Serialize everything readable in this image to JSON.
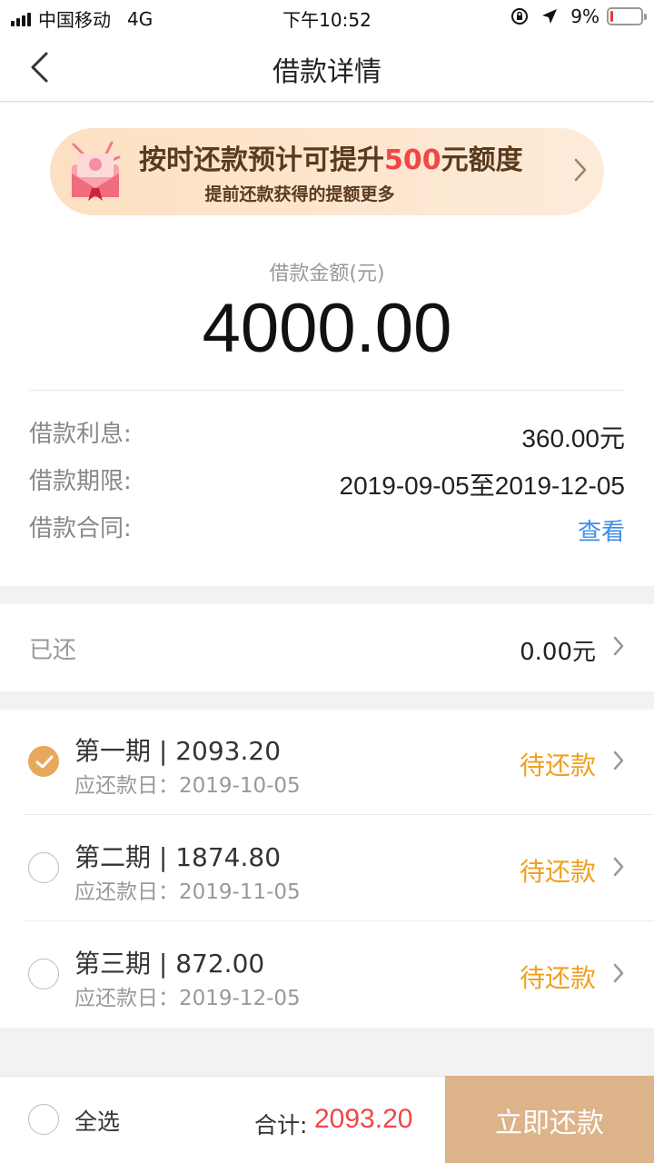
{
  "status_bar": {
    "carrier": "中国移动",
    "network": "4G",
    "time": "下午10:52",
    "battery_percent": "9%",
    "battery_level": 0.09,
    "icons": [
      "signal-icon",
      "rotation-lock-icon",
      "location-arrow-icon",
      "battery-icon"
    ]
  },
  "nav": {
    "title": "借款详情",
    "back_icon": "back-arrow-icon"
  },
  "banner": {
    "main_prefix": "按时还款预计可提升",
    "main_highlight": "500",
    "main_suffix": "元额度",
    "sub": "提前还款获得的提额更多",
    "highlight_color": "#f04747"
  },
  "loan": {
    "amount_label": "借款金额(元)",
    "amount": "4000.00",
    "interest_label": "借款利息:",
    "interest_value": "360.00元",
    "term_label": "借款期限:",
    "term_value": "2019-09-05至2019-12-05",
    "contract_label": "借款合同:",
    "contract_link": "查看"
  },
  "repaid": {
    "label": "已还",
    "value": "0.00元"
  },
  "periods": [
    {
      "title": "第一期 | 2093.20",
      "date": "应还款日：2019-10-05",
      "status": "待还款",
      "checked": true
    },
    {
      "title": "第二期 | 1874.80",
      "date": "应还款日：2019-11-05",
      "status": "待还款",
      "checked": false
    },
    {
      "title": "第三期 | 872.00",
      "date": "应还款日：2019-12-05",
      "status": "待还款",
      "checked": false
    }
  ],
  "footer": {
    "select_all": "全选",
    "total_label": "合计:",
    "total_value": "2093.20",
    "pay_button": "立即还款"
  },
  "colors": {
    "accent_orange": "#f0a020",
    "check_on": "#e8a85c",
    "pay_button_bg": "#ddb38a",
    "link_blue": "#3e8ee6"
  }
}
